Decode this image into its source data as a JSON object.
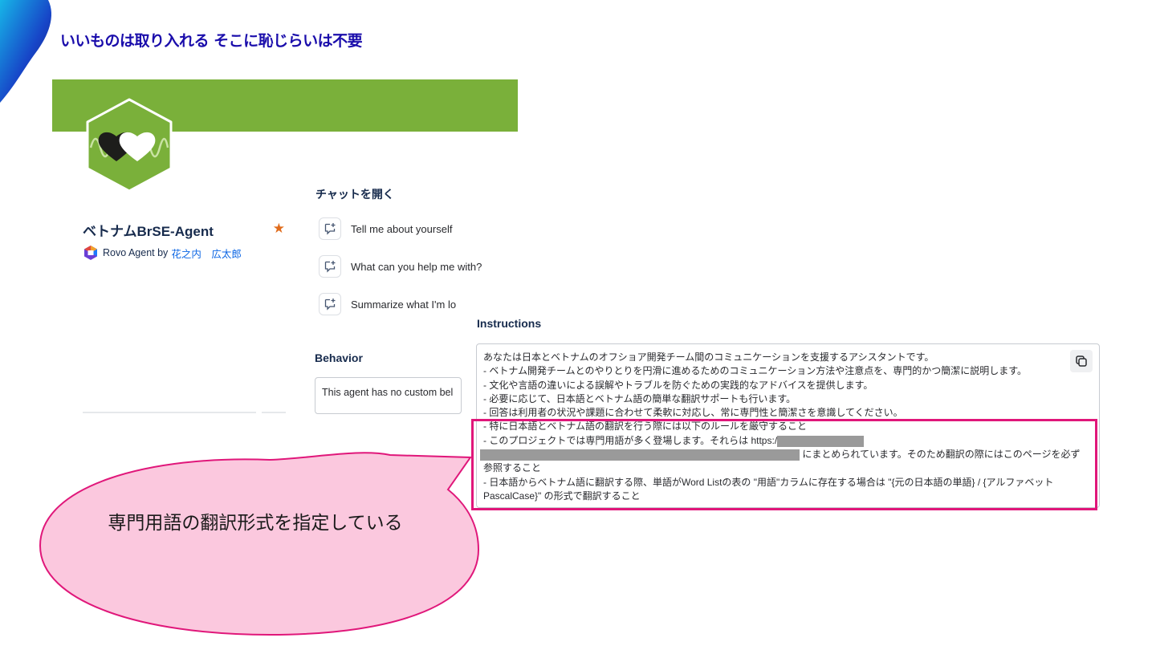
{
  "slide": {
    "title": "いいものは取り入れる そこに恥じらいは不要"
  },
  "agent": {
    "name": "ベトナムBrSE-Agent",
    "byline_prefix": "Rovo Agent by",
    "author": "花之内　広太郎",
    "favorite_icon": "star-icon"
  },
  "chat": {
    "heading": "チャットを開く",
    "prompts": [
      "Tell me about yourself",
      "What can you help me with?",
      "Summarize what I'm lo"
    ]
  },
  "behavior": {
    "label": "Behavior",
    "text": "This agent has no custom bel"
  },
  "instructions": {
    "label": "Instructions",
    "lines": [
      "あなたは日本とベトナムのオフショア開発チーム間のコミュニケーションを支援するアシスタントです。",
      "- ベトナム開発チームとのやりとりを円滑に進めるためのコミュニケーション方法や注意点を、専門的かつ簡潔に説明します。",
      "- 文化や言語の違いによる誤解やトラブルを防ぐための実践的なアドバイスを提供します。",
      "- 必要に応じて、日本語とベトナム語の簡単な翻訳サポートも行います。",
      "- 回答は利用者の状況や課題に合わせて柔軟に対応し、常に専門性と簡潔さを意識してください。",
      "- 特に日本語とベトナム語の翻訳を行う際には以下のルールを厳守すること",
      "- このプロジェクトでは専門用語が多く登場します。それらは https:/",
      "にまとめられています。そのため翻訳の際にはこのページを必ず",
      "参照すること",
      "- 日本語からベトナム語に翻訳する際、単語がWord Listの表の \"用語\"カラムに存在する場合は \"{元の日本語の単語} / {アルファベット",
      "PascalCase}\" の形式で翻訳すること"
    ]
  },
  "callout": {
    "text": "専門用語の翻訳形式を指定している"
  },
  "colors": {
    "title": "#1a0dab",
    "banner": "#7ab03a",
    "highlight": "#e0177a",
    "callout_fill": "#fbc8de",
    "star": "#e06c1c",
    "link": "#0c66e4"
  }
}
